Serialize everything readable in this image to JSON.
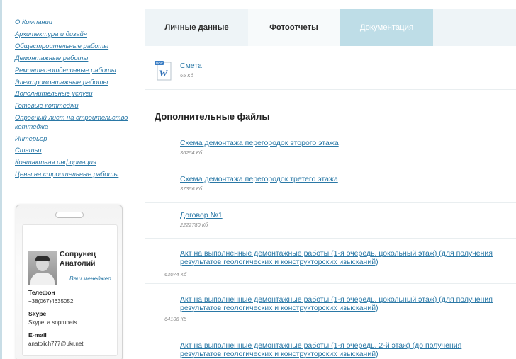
{
  "sidebar": {
    "nav": [
      "О Компании",
      "Архитектура и дизайн",
      "Общестроительные работы",
      "Демонтажные работы",
      "Ремонтно-отделочные работы",
      "Электромонтажные работы",
      "Дополнительные услуги",
      "Готовые коттеджи",
      "Опросный лист на строительство коттеджа",
      "Интерьер",
      "Статьи",
      "Контактная информация",
      "Цены на строительные работы"
    ],
    "manager": {
      "name": "Сопрунец Анатолий",
      "role": "Ваш менеджер",
      "phone_label": "Телефон",
      "phone": "+38(067)4635052",
      "skype_label": "Skype",
      "skype": "Skype: a.soprunets",
      "email_label": "E-mail",
      "email": "anatolich777@ukr.net"
    }
  },
  "tabs": {
    "personal": "Личные данные",
    "photo": "Фотоотчеты",
    "docs": "Документация"
  },
  "main": {
    "doc_file": {
      "name": "Смета",
      "size": "65 Кб"
    },
    "section_title": "Дополнительные файлы",
    "files": [
      {
        "name": "Схема демонтажа перегородок второго этажа",
        "size": "36254 Кб"
      },
      {
        "name": "Схема демонтажа перегородок третего этажа",
        "size": "37356 Кб"
      },
      {
        "name": "Договор №1",
        "size": "2222780 Кб"
      },
      {
        "name": "Акт на выполненные демонтажные работы (1-я очередь, цокольный этаж) (для получения результатов геологических и конструкторских изысканий)",
        "size": "63074 Кб"
      },
      {
        "name": "Акт на выполненные демонтажные работы (1-я очередь, цокольный этаж) (для получения результатов геологических и конструкторских изысканий)",
        "size": "64106 Кб"
      },
      {
        "name": "Акт на выполненные демонтажные работы (1-я очередь, 2-й этаж) (до получения результатов геологических и конструкторских изысканий)",
        "size": ""
      }
    ]
  },
  "colors": {
    "link": "#2a78a6",
    "tab_active_bg": "#bedde7",
    "tabs_bg": "#eef4f7"
  }
}
